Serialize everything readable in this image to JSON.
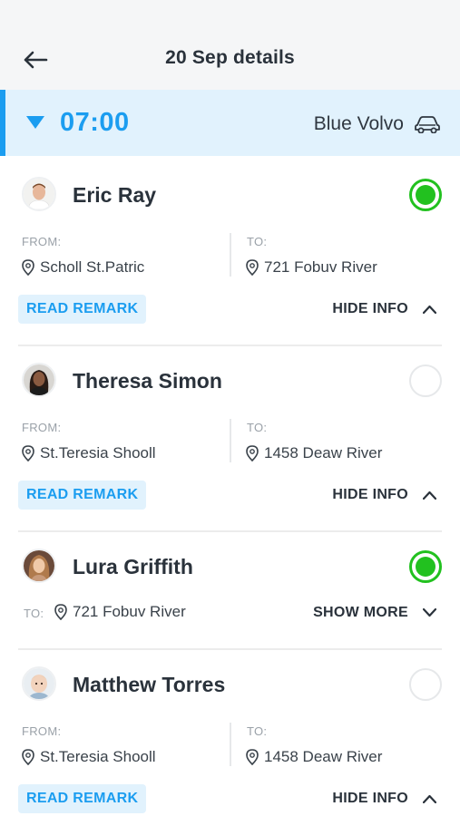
{
  "header": {
    "title": "20 Sep details"
  },
  "trip": {
    "time": "07:00",
    "vehicle": "Blue Volvo"
  },
  "labels": {
    "from": "FROM:",
    "to": "TO:",
    "read_remark": "READ REMARK",
    "hide_info": "HIDE INFO",
    "show_more": "SHOW MORE"
  },
  "passengers": [
    {
      "name": "Eric Ray",
      "from": "Scholl St.Patric",
      "to": "721 Fobuv River",
      "checked": true
    },
    {
      "name": "Theresa Simon",
      "from": "St.Teresia Shooll",
      "to": "1458 Deaw River",
      "checked": false
    },
    {
      "name": "Lura Griffith",
      "to": "721 Fobuv River",
      "checked": true
    },
    {
      "name": "Matthew Torres",
      "from": "St.Teresia Shooll",
      "to": "1458 Deaw River",
      "checked": false
    }
  ],
  "colors": {
    "accent": "#1b9df0",
    "accent_bg": "#e1f2fd",
    "check_green": "#22c11f"
  },
  "icons": [
    "back-arrow-icon",
    "collapse-triangle-icon",
    "car-icon",
    "location-pin-icon",
    "chevron-up-icon",
    "chevron-down-icon"
  ]
}
